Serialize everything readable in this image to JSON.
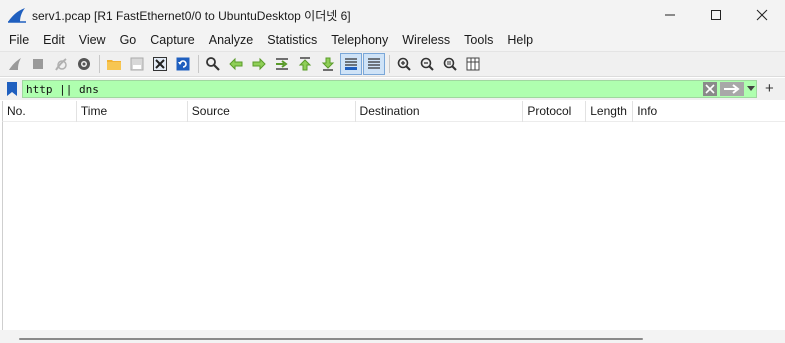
{
  "window": {
    "title": "serv1.pcap [R1 FastEthernet0/0 to UbuntuDesktop 이더넷 6]",
    "icons": [
      "wireshark-shark-fin-icon",
      "minimize-icon",
      "maximize-icon",
      "close-icon"
    ]
  },
  "menu": {
    "items": [
      "File",
      "Edit",
      "View",
      "Go",
      "Capture",
      "Analyze",
      "Statistics",
      "Telephony",
      "Wireless",
      "Tools",
      "Help"
    ]
  },
  "toolbar": {
    "buttons": [
      "start-capture-icon",
      "stop-capture-icon",
      "restart-capture-icon",
      "capture-options-icon",
      "open-file-icon",
      "save-file-icon",
      "close-file-icon",
      "reload-file-icon",
      "find-packet-icon",
      "go-back-icon",
      "go-forward-icon",
      "go-to-packet-icon",
      "go-first-icon",
      "go-last-icon",
      "auto-scroll-icon",
      "colorize-icon",
      "zoom-in-icon",
      "zoom-out-icon",
      "normal-size-icon",
      "resize-columns-icon"
    ],
    "active": [
      "auto-scroll-icon",
      "colorize-icon"
    ]
  },
  "filter": {
    "value": "http || dns",
    "background": "#afffaf",
    "icons": [
      "bookmark-icon",
      "clear-filter-icon",
      "apply-filter-icon",
      "filter-dropdown-icon",
      "add-filter-button-icon"
    ]
  },
  "packet_list": {
    "columns": [
      "No.",
      "Time",
      "Source",
      "Destination",
      "Protocol",
      "Length",
      "Info"
    ],
    "rows": []
  }
}
